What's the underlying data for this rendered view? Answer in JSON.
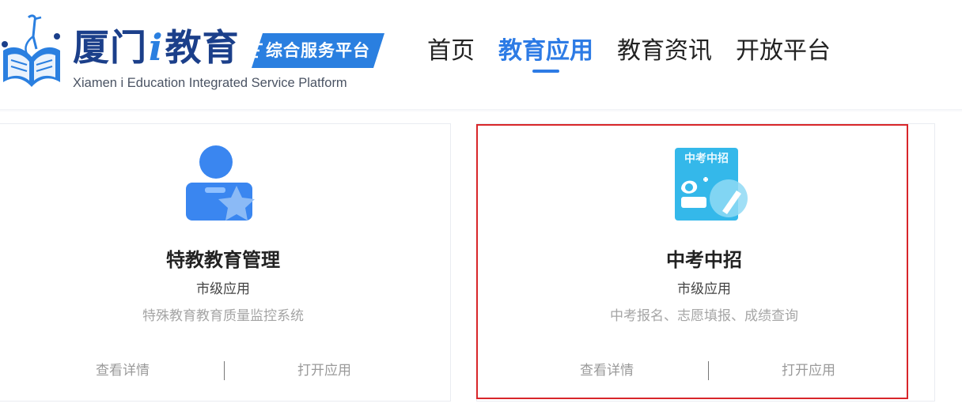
{
  "header": {
    "logo_cn_a": "厦门",
    "logo_cn_i": "i",
    "logo_cn_b": "教育",
    "logo_badge": "综合服务平台",
    "logo_en": "Xiamen i Education Integrated Service Platform",
    "brand_color": "#2d7be5",
    "nav": [
      {
        "label": "首页",
        "active": false
      },
      {
        "label": "教育应用",
        "active": true
      },
      {
        "label": "教育资讯",
        "active": false
      },
      {
        "label": "开放平台",
        "active": false
      }
    ]
  },
  "cards": [
    {
      "icon": "special-education-user-star-icon",
      "title": "特教教育管理",
      "level": "市级应用",
      "description": "特殊教育教育质量监控系统",
      "details_label": "查看详情",
      "open_label": "打开应用",
      "selected": false
    },
    {
      "icon": "exam-enrollment-card-icon",
      "icon_text": "中考中招",
      "title": "中考中招",
      "level": "市级应用",
      "description": "中考报名、志愿填报、成绩查询",
      "details_label": "查看详情",
      "open_label": "打开应用",
      "selected": true,
      "selection_color": "#d8262a"
    }
  ]
}
